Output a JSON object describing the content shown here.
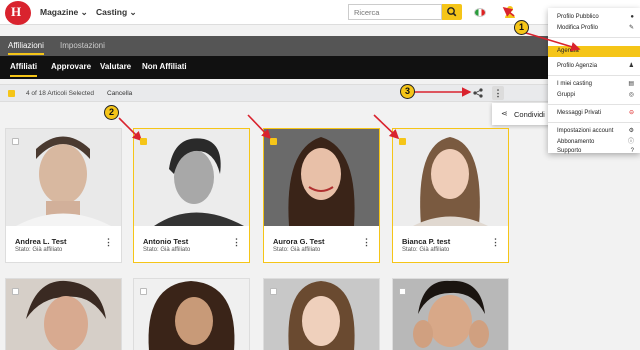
{
  "nav": {
    "logo_text": "H",
    "magazine": "Magazine",
    "casting": "Casting",
    "search_placeholder": "Ricerca"
  },
  "tabs": [
    "Affiliazioni",
    "Impostazioni"
  ],
  "subtabs": [
    "Affiliati",
    "Approvare",
    "Valutare",
    "Non Affiliati"
  ],
  "selection": {
    "text": "4 of 18 Articoli Selected",
    "cancel": "Cancella"
  },
  "share_popup": {
    "label": "Condividi"
  },
  "cards": [
    {
      "name": "Andrea L. Test",
      "status": "Stato: Già affiliato",
      "selected": false
    },
    {
      "name": "Antonio Test",
      "status": "Stato: Già affiliato",
      "selected": true
    },
    {
      "name": "Aurora G. Test",
      "status": "Stato: Già affiliato",
      "selected": true
    },
    {
      "name": "Bianca P. test",
      "status": "Stato: Già affiliato",
      "selected": true
    }
  ],
  "menu": {
    "items": [
      "Profilo Pubblico",
      "Modifica Profilo",
      "Agenzia",
      "Profilo Agenzia",
      "I miei casting",
      "Gruppi",
      "Messaggi Privati",
      "Impostazioni account",
      "Abbonamento",
      "Supporto"
    ]
  },
  "annotations": [
    "1",
    "2",
    "3"
  ],
  "colors": {
    "accent": "#f5c518",
    "dark": "#111111",
    "annotation_arrow": "#d9232e"
  }
}
